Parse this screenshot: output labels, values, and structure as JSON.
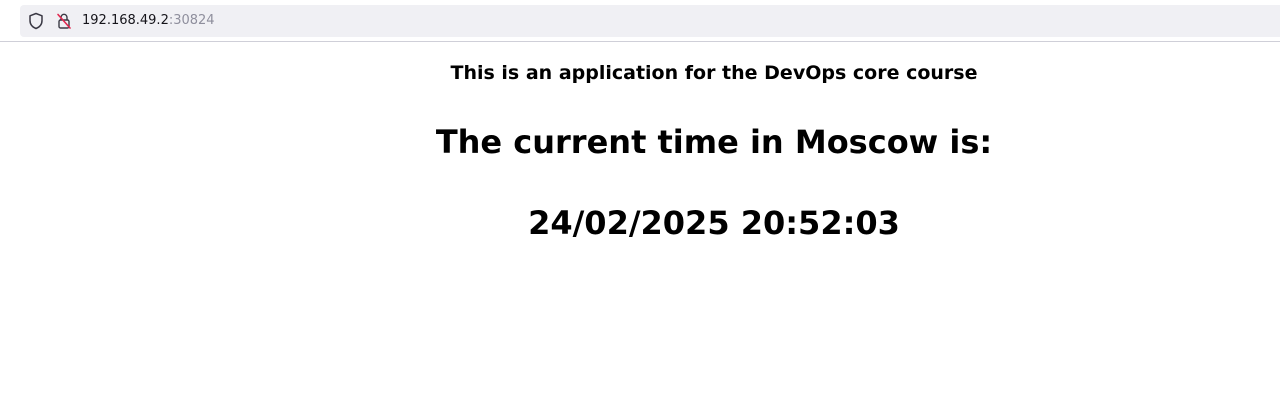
{
  "browser": {
    "address_bar": {
      "host": "192.168.49.2",
      "port": ":30824",
      "icons": [
        "shield-icon",
        "insecure-lock-icon"
      ]
    }
  },
  "page": {
    "subtitle": "This is an application for the DevOps core course",
    "heading": "The current time in Moscow is:",
    "time": "24/02/2025 20:52:03"
  }
}
